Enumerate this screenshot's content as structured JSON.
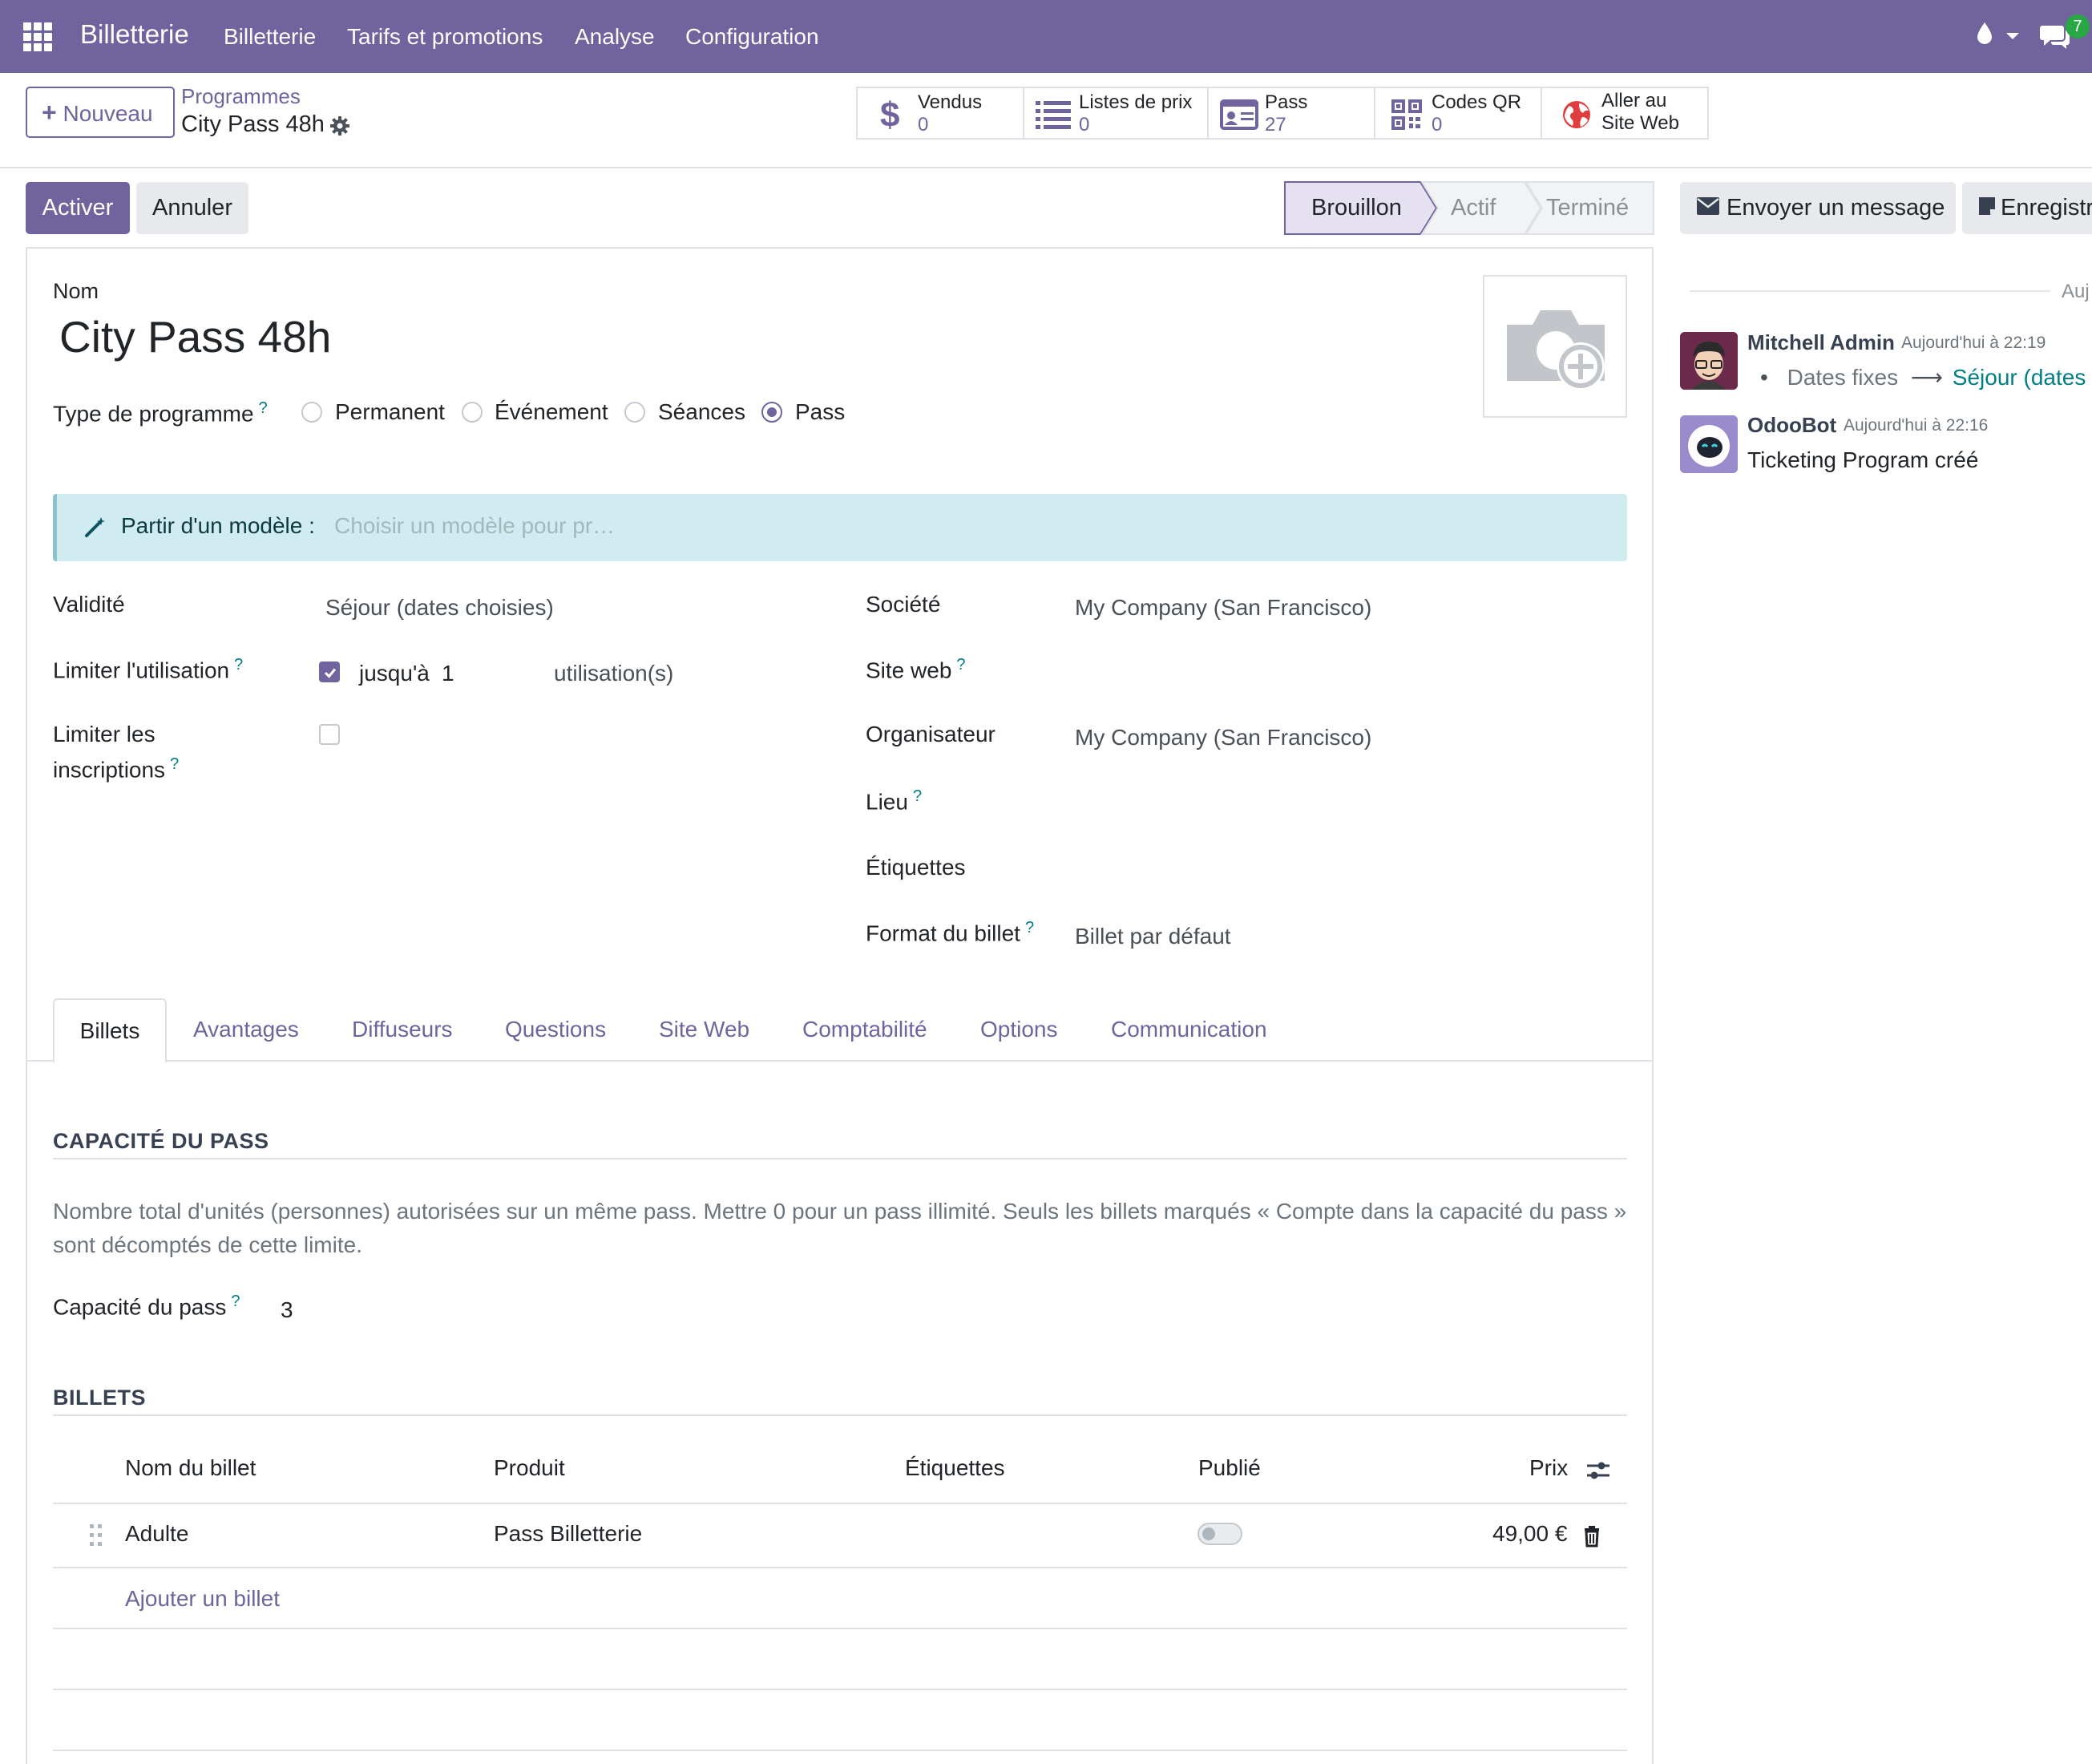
{
  "navbar": {
    "app_name": "Billetterie",
    "menus": [
      "Billetterie",
      "Tarifs et promotions",
      "Analyse",
      "Configuration"
    ],
    "messages_badge": "7"
  },
  "control_panel": {
    "new_label": "Nouveau",
    "breadcrumb_parent": "Programmes",
    "breadcrumb_current": "City Pass 48h",
    "smart_buttons": [
      {
        "label": "Vendus",
        "value": "0",
        "icon": "dollar-icon"
      },
      {
        "label": "Listes de prix",
        "value": "0",
        "icon": "list-icon"
      },
      {
        "label": "Pass",
        "value": "27",
        "icon": "id-card-icon"
      },
      {
        "label": "Codes QR",
        "value": "0",
        "icon": "qrcode-icon"
      },
      {
        "label_line1": "Aller au",
        "label_line2": "Site Web",
        "icon": "globe-icon"
      }
    ]
  },
  "status_bar": {
    "activate_label": "Activer",
    "cancel_label": "Annuler",
    "stages": [
      "Brouillon",
      "Actif",
      "Terminé"
    ],
    "current_stage": "Brouillon"
  },
  "chatter_buttons": {
    "send_message": "Envoyer un message",
    "log_note": "Enregistr"
  },
  "form": {
    "name_label": "Nom",
    "name_value": "City Pass 48h",
    "program_type_label": "Type de programme",
    "program_type_options": [
      "Permanent",
      "Événement",
      "Séances",
      "Pass"
    ],
    "program_type_selected": "Pass",
    "template_label": "Partir d'un modèle :",
    "template_placeholder": "Choisir un modèle pour pr…",
    "validity_label": "Validité",
    "validity_value": "Séjour (dates choisies)",
    "limit_usage_label": "Limiter l'utilisation",
    "limit_usage_checked": true,
    "limit_usage_prefix": "jusqu'à",
    "limit_usage_value": "1",
    "limit_usage_suffix": "utilisation(s)",
    "limit_registrations_label_1": "Limiter les",
    "limit_registrations_label_2": "inscriptions",
    "limit_registrations_checked": false,
    "company_label": "Société",
    "company_value": "My Company (San Francisco)",
    "website_label": "Site web",
    "organizer_label": "Organisateur",
    "organizer_value": "My Company (San Francisco)",
    "venue_label": "Lieu",
    "tags_label": "Étiquettes",
    "ticket_format_label": "Format du billet",
    "ticket_format_value": "Billet par défaut"
  },
  "tabs": [
    "Billets",
    "Avantages",
    "Diffuseurs",
    "Questions",
    "Site Web",
    "Comptabilité",
    "Options",
    "Communication"
  ],
  "active_tab": "Billets",
  "pass_capacity": {
    "section_title": "CAPACITÉ DU PASS",
    "help_line1": "Nombre total d'unités (personnes) autorisées sur un même pass. Mettre 0 pour un pass illimité. Seuls les billets marqués « Compte dans la capacité du pass »",
    "help_line2": "sont décomptés de cette limite.",
    "label": "Capacité du pass",
    "value": "3"
  },
  "tickets": {
    "section_title": "BILLETS",
    "columns": [
      "Nom du billet",
      "Produit",
      "Étiquettes",
      "Publié",
      "Prix"
    ],
    "rows": [
      {
        "name": "Adulte",
        "product": "Pass Billetterie",
        "tags": "",
        "published": false,
        "price": "49,00 €"
      }
    ],
    "add_label": "Ajouter un billet"
  },
  "chatter": {
    "date_separator": "Auj",
    "messages": [
      {
        "author": "Mitchell Admin",
        "time": "Aujourd'hui à 22:19",
        "change_old": "Dates fixes",
        "change_new": "Séjour (dates"
      },
      {
        "author": "OdooBot",
        "time": "Aujourd'hui à 22:16",
        "body": "Ticketing Program créé"
      }
    ]
  },
  "colors": {
    "brand": "#71639e",
    "link": "#017e84",
    "alert_bg": "#d1ecf1",
    "badge": "#28a745"
  }
}
